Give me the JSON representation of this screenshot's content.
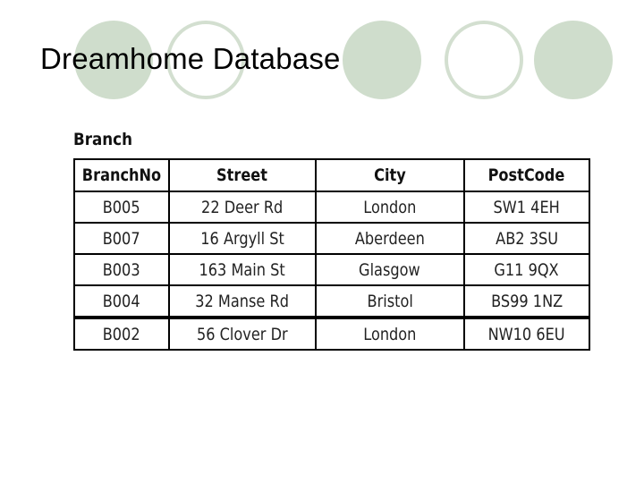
{
  "slide": {
    "title": "Dreamhome Database",
    "decor_colors": {
      "circle_fill": "#cfddcc",
      "circle_outline": "#d3dfd0"
    }
  },
  "table": {
    "caption": "Branch",
    "columns": [
      "BranchNo",
      "Street",
      "City",
      "PostCode"
    ],
    "rows": [
      [
        "B005",
        "22 Deer Rd",
        "London",
        "SW1 4EH"
      ],
      [
        "B007",
        "16 Argyll St",
        "Aberdeen",
        "AB2 3SU"
      ],
      [
        "B003",
        "163 Main St",
        "Glasgow",
        "G11 9QX"
      ],
      [
        "B004",
        "32 Manse Rd",
        "Bristol",
        "BS99 1NZ"
      ],
      [
        "B002",
        "56 Clover Dr",
        "London",
        "NW10 6EU"
      ]
    ]
  }
}
